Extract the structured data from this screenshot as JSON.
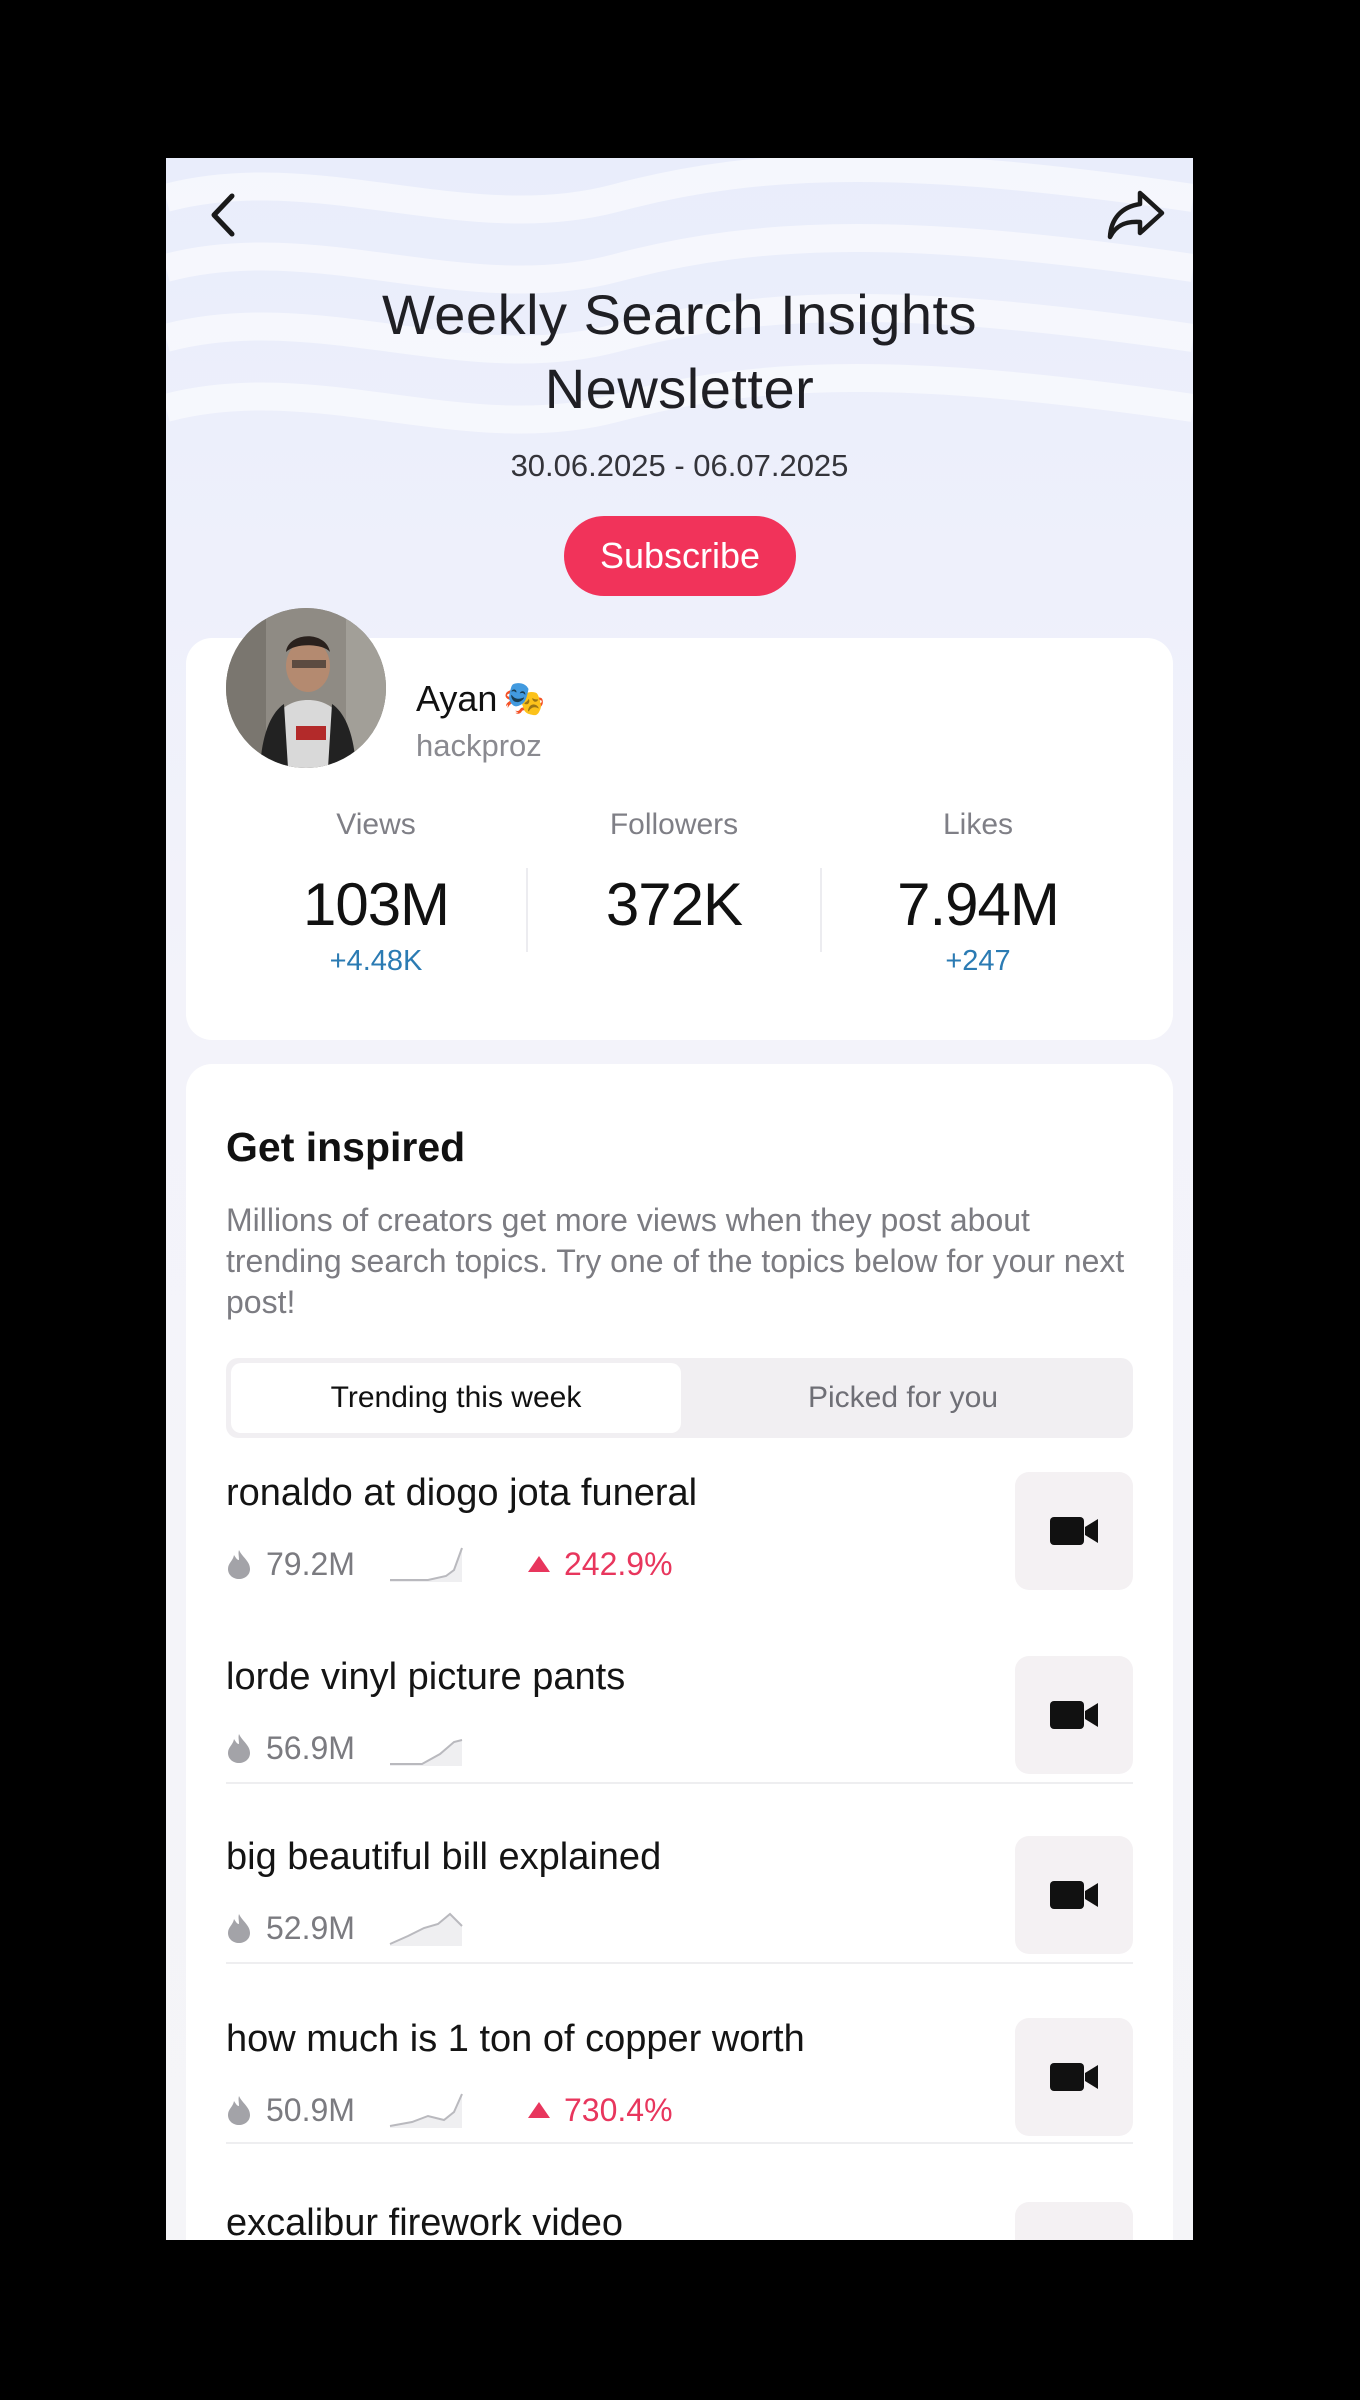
{
  "header": {
    "title_line1": "Weekly Search Insights",
    "title_line2": "Newsletter",
    "date_range": "30.06.2025 - 06.07.2025",
    "subscribe_label": "Subscribe",
    "back_icon": "chevron-left-icon",
    "share_icon": "share-arrow-icon"
  },
  "profile": {
    "name": "Ayan",
    "name_emoji": "🎭",
    "handle": "hackproz",
    "stats": [
      {
        "label": "Views",
        "value": "103M",
        "delta": "+4.48K"
      },
      {
        "label": "Followers",
        "value": "372K",
        "delta": ""
      },
      {
        "label": "Likes",
        "value": "7.94M",
        "delta": "+247"
      }
    ]
  },
  "inspire": {
    "title": "Get inspired",
    "description": "Millions of creators get more views when they post about trending search topics. Try one of the topics below for your next post!",
    "tabs": [
      {
        "label": "Trending this week",
        "active": true
      },
      {
        "label": "Picked for you",
        "active": false
      }
    ],
    "topics": [
      {
        "title": "ronaldo at diogo jota funeral",
        "count": "79.2M",
        "change": "242.9%"
      },
      {
        "title": "lorde vinyl picture pants",
        "count": "56.9M",
        "change": ""
      },
      {
        "title": "big beautiful bill explained",
        "count": "52.9M",
        "change": ""
      },
      {
        "title": "how much is 1 ton of copper worth",
        "count": "50.9M",
        "change": "730.4%"
      },
      {
        "title": "excalibur firework video",
        "count": "",
        "change": ""
      }
    ]
  },
  "colors": {
    "accent": "#f1335a",
    "delta_blue": "#2b7bb3",
    "trend_up": "#e8365d"
  }
}
